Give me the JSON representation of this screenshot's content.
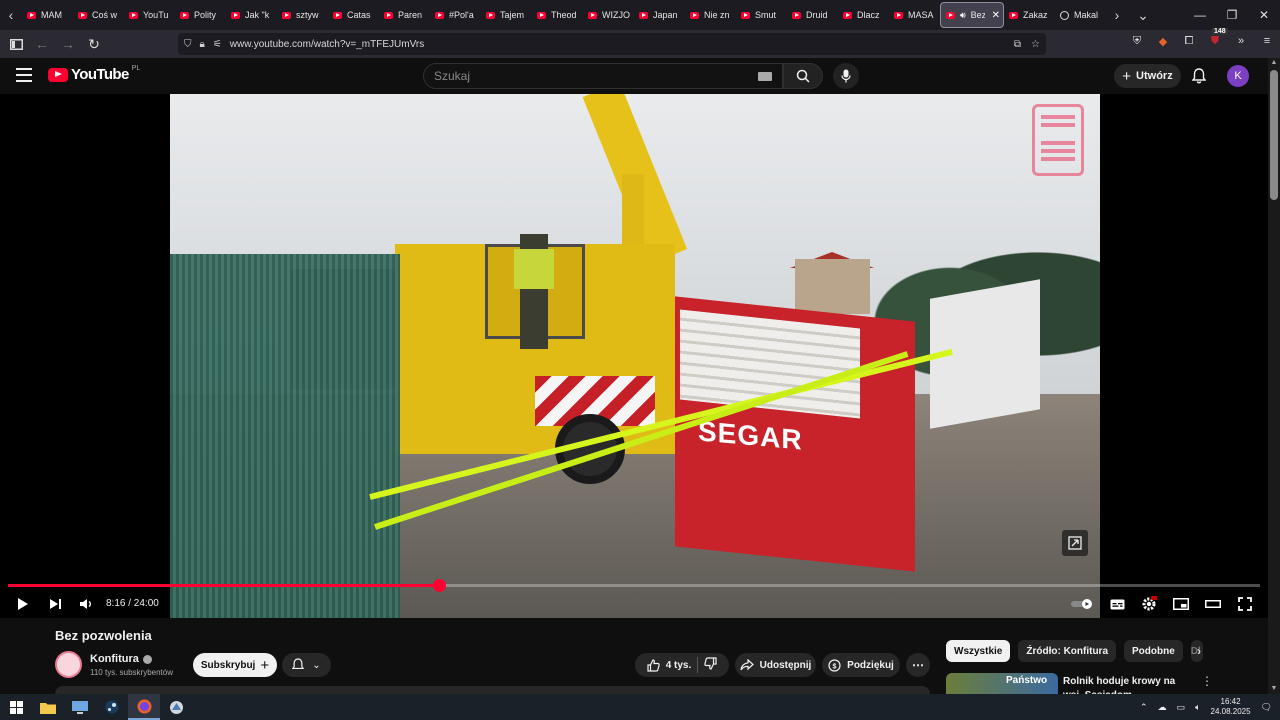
{
  "browser": {
    "tabs": [
      {
        "title": "MAM"
      },
      {
        "title": "Coś w"
      },
      {
        "title": "YouTu"
      },
      {
        "title": "Polity"
      },
      {
        "title": "Jak \"k"
      },
      {
        "title": "sztyw"
      },
      {
        "title": "Catas"
      },
      {
        "title": "Paren"
      },
      {
        "title": "#Pol'a"
      },
      {
        "title": "Tajem"
      },
      {
        "title": "Theod"
      },
      {
        "title": "WIZJO"
      },
      {
        "title": "Japan"
      },
      {
        "title": "Nie zn"
      },
      {
        "title": "Smut"
      },
      {
        "title": "Druid"
      },
      {
        "title": "Dlacz"
      },
      {
        "title": "MASA"
      }
    ],
    "active_tab": {
      "title": "Bez"
    },
    "trailing_tabs": [
      {
        "title": "Zakaz",
        "icon": "youtube"
      },
      {
        "title": "Makal",
        "icon": "globe"
      }
    ],
    "url": "www.youtube.com/watch?v=_mTFEJUmVrs",
    "extension_badge": "148"
  },
  "youtube": {
    "logo_text": "YouTube",
    "country_code": "PL",
    "search_placeholder": "Szukaj",
    "create_label": "Utwórz",
    "avatar_letter": "K"
  },
  "player": {
    "current_time": "8:16",
    "duration": "24:00",
    "time_display": "8:16 / 24:00",
    "progress_fraction": 0.344,
    "video_text": "SEGAR"
  },
  "video": {
    "title": "Bez pozwolenia",
    "channel_name": "Konfitura",
    "subscribers": "110 tys. subskrybentów",
    "subscribe_label": "Subskrybuj",
    "likes": "4 tys.",
    "share_label": "Udostępnij",
    "thanks_label": "Podziękuj"
  },
  "filter_chips": [
    "Wszystkie",
    "Źródło: Konfitura",
    "Podobne",
    "Dl"
  ],
  "recommended": {
    "title": "Rolnik hoduje krowy na wsi. Sąsiadom przeszkadza zapac",
    "thumb_text": "Państwo"
  },
  "taskbar": {
    "time": "16:42",
    "date": "24.08.2025"
  },
  "colors": {
    "yt_red": "#ff0033",
    "background": "#0f0f0f",
    "pill": "#272727"
  }
}
